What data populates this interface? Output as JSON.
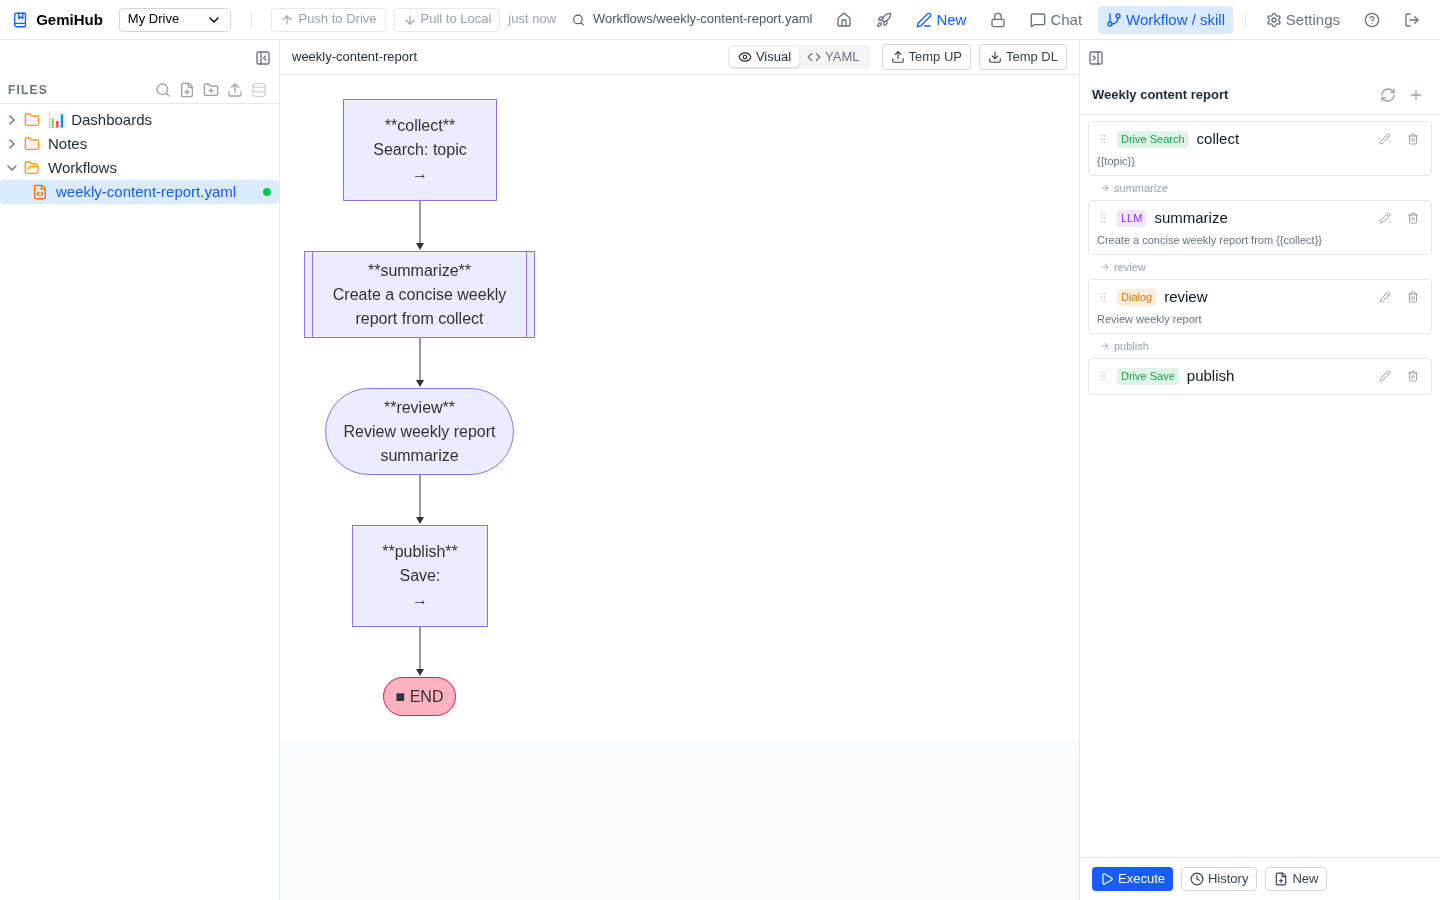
{
  "app": {
    "name": "GemiHub",
    "drive": "My Drive"
  },
  "sync": {
    "push": "Push to Drive",
    "pull": "Pull to Local",
    "status": "just now"
  },
  "path": "Workflows/weekly-content-report.yaml",
  "nav": [
    {
      "kind": "icon",
      "selected": false
    },
    {
      "kind": "icon",
      "selected": false
    },
    {
      "kind": "new",
      "label": "New",
      "selected": false
    },
    {
      "kind": "icon",
      "selected": false
    },
    {
      "kind": "text",
      "label": "Chat",
      "selected": false
    },
    {
      "kind": "text",
      "label": "Workflow / skill",
      "selected": true
    },
    {
      "kind": "divider"
    },
    {
      "kind": "text",
      "label": "Settings",
      "selected": false
    },
    {
      "kind": "icon",
      "selected": false
    },
    {
      "kind": "icon",
      "selected": false
    }
  ],
  "sidebar": {
    "title": "FILES",
    "tree": [
      {
        "name": "📊 Dashboards",
        "expanded": false
      },
      {
        "name": "Notes",
        "expanded": false
      },
      {
        "name": "Workflows",
        "expanded": true,
        "children": [
          {
            "name": "weekly-content-report.yaml",
            "selected": true,
            "modified": true
          }
        ]
      }
    ]
  },
  "editor": {
    "title": "weekly-content-report",
    "views": [
      {
        "label": "Visual",
        "selected": true
      },
      {
        "label": "YAML",
        "selected": false
      }
    ],
    "actions": [
      "Temp UP",
      "Temp DL"
    ]
  },
  "flow": [
    {
      "kind": "process",
      "lines": [
        "**collect**",
        "Search: topic",
        "→"
      ]
    },
    {
      "kind": "subroutine",
      "lines": [
        "**summarize**",
        "Create a concise weekly",
        "report from collect"
      ]
    },
    {
      "kind": "stadium",
      "lines": [
        "**review**",
        "Review weekly report",
        "summarize"
      ]
    },
    {
      "kind": "process",
      "lines": [
        "**publish**",
        "Save:",
        "→"
      ]
    },
    {
      "kind": "end",
      "lines": [
        "■ END"
      ]
    }
  ],
  "panel": {
    "title": "Weekly content report",
    "steps": [
      {
        "tag": "Drive Search",
        "color": "#16a34a",
        "name": "collect",
        "detail": "{{topic}}",
        "next": "summarize"
      },
      {
        "tag": "LLM",
        "color": "#9333ea",
        "name": "summarize",
        "detail": "Create a concise weekly report from {{collect}}",
        "next": "review"
      },
      {
        "tag": "Dialog",
        "color": "#d97706",
        "name": "review",
        "detail": "Review weekly report",
        "next": "publish"
      },
      {
        "tag": "Drive Save",
        "color": "#16a34a",
        "name": "publish"
      }
    ],
    "buttons": [
      {
        "label": "Execute",
        "kind": "primary"
      },
      {
        "label": "History",
        "kind": "outline"
      },
      {
        "label": "New",
        "kind": "outline"
      }
    ]
  }
}
